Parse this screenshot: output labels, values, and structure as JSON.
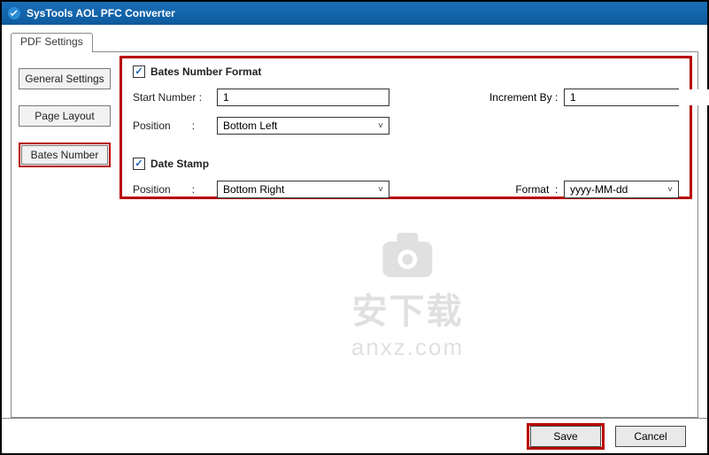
{
  "titlebar": {
    "title": "SysTools  AOL PFC Converter"
  },
  "tab": {
    "label": "PDF Settings"
  },
  "sidebar": {
    "items": [
      {
        "label": "General Settings"
      },
      {
        "label": "Page Layout"
      },
      {
        "label": "Bates Number"
      }
    ]
  },
  "bates": {
    "section_title": "Bates Number Format",
    "start_label": "Start Number",
    "start_value": "1",
    "increment_label": "Increment By",
    "increment_value": "1",
    "position_label": "Position",
    "position_value": "Bottom Left"
  },
  "dateStamp": {
    "section_title": "Date Stamp",
    "position_label": "Position",
    "position_value": "Bottom Right",
    "format_label": "Format",
    "format_value": "yyyy-MM-dd"
  },
  "watermark": {
    "text": "安下载",
    "url": "anxz.com"
  },
  "footer": {
    "save": "Save",
    "cancel": "Cancel"
  }
}
